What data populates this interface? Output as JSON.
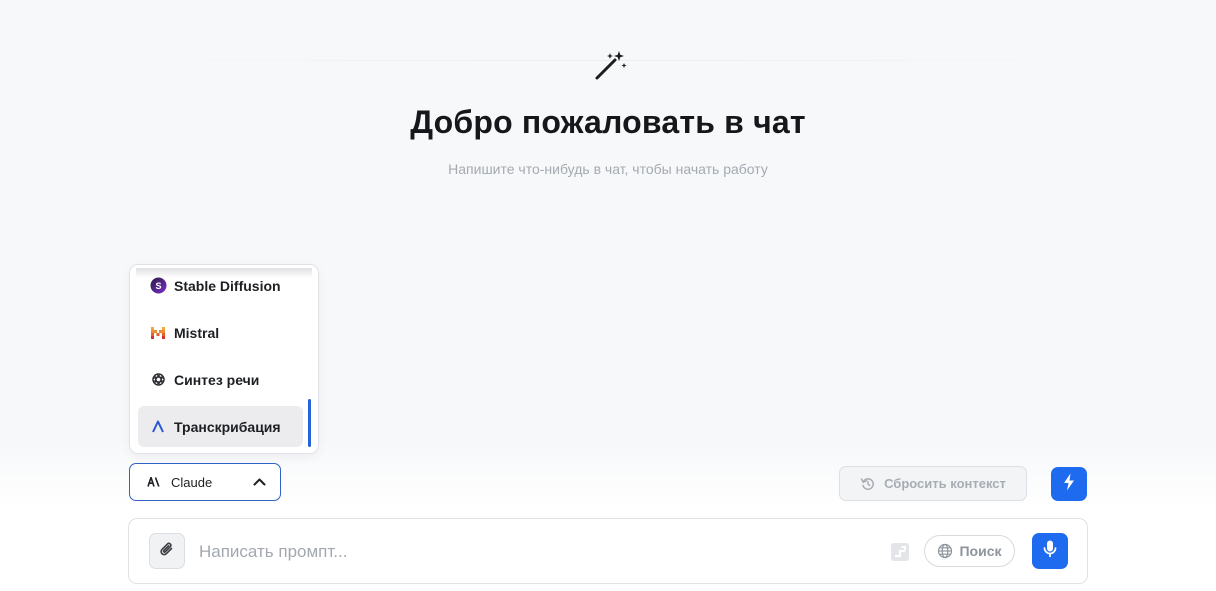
{
  "welcome": {
    "title": "Добро пожаловать в чат",
    "subtitle": "Напишите что-нибудь в чат, чтобы начать работу",
    "icon": "magic-wand-icon"
  },
  "model_menu": {
    "items": [
      {
        "label": "Stable Diffusion",
        "icon": "stable-diffusion-icon"
      },
      {
        "label": "Mistral",
        "icon": "mistral-icon"
      },
      {
        "label": "Синтез речи",
        "icon": "openai-icon"
      },
      {
        "label": "Транскрибация",
        "icon": "assembly-icon",
        "active": true
      }
    ]
  },
  "model_select": {
    "label": "Claude",
    "icon": "anthropic-icon",
    "accent": "#2f62c4"
  },
  "actions": {
    "reset_label": "Сбросить контекст",
    "bolt_icon": "lightning-icon"
  },
  "prompt": {
    "placeholder": "Написать промпт...",
    "search_label": "Поиск"
  },
  "colors": {
    "primary": "#1f6bf0",
    "background": "#f7f8fa"
  }
}
